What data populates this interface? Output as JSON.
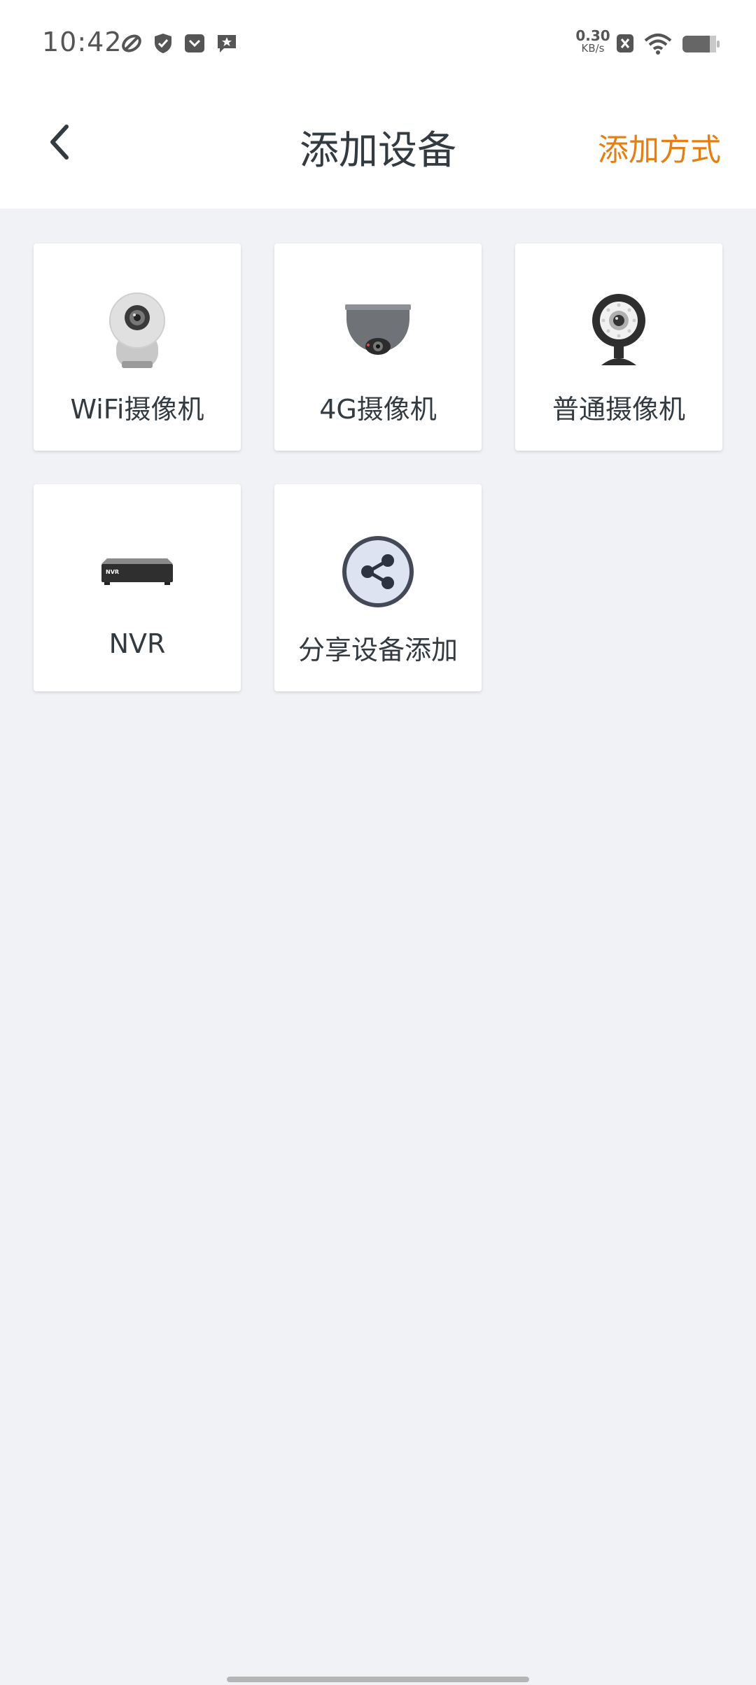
{
  "status_bar": {
    "time": "10:42",
    "net_speed_value": "0.30",
    "net_speed_unit": "KB/s",
    "left_icons": [
      "sync-icon",
      "shield-icon",
      "pocket-icon",
      "star-message-icon"
    ],
    "right_icons": [
      "close-box-icon",
      "wifi-icon",
      "battery-icon"
    ]
  },
  "header": {
    "title": "添加设备",
    "add_method_label": "添加方式",
    "accent_color": "#e67e12"
  },
  "devices": [
    {
      "label": "WiFi摄像机",
      "icon": "wifi-camera-icon"
    },
    {
      "label": "4G摄像机",
      "icon": "dome-camera-icon"
    },
    {
      "label": "普通摄像机",
      "icon": "webcam-icon"
    },
    {
      "label": "NVR",
      "icon": "nvr-icon",
      "device_text": "NVR"
    },
    {
      "label": "分享设备添加",
      "icon": "share-icon"
    }
  ]
}
